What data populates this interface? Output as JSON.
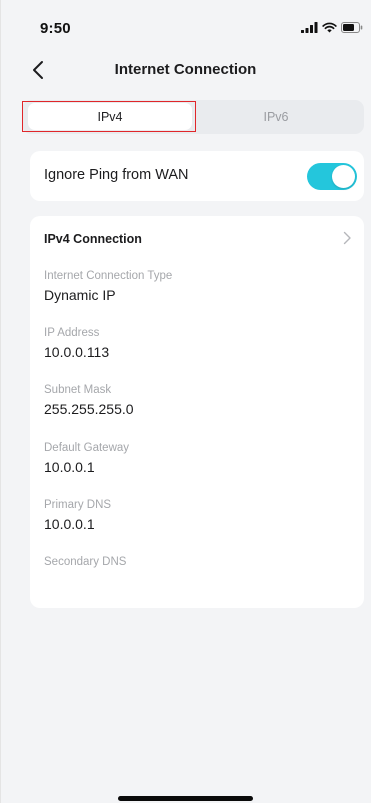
{
  "status_bar": {
    "time": "9:50",
    "icons": [
      "signal-icon",
      "wifi-icon",
      "battery-icon"
    ]
  },
  "nav": {
    "title": "Internet Connection",
    "back_icon": "chevron-left-icon"
  },
  "tabs": {
    "items": [
      {
        "label": "IPv4",
        "selected": true
      },
      {
        "label": "IPv6",
        "selected": false
      }
    ]
  },
  "ping": {
    "label": "Ignore Ping from WAN",
    "enabled": true
  },
  "connection": {
    "title": "IPv4 Connection",
    "fields": [
      {
        "label": "Internet Connection Type",
        "value": "Dynamic IP"
      },
      {
        "label": "IP Address",
        "value": "10.0.0.113"
      },
      {
        "label": "Subnet Mask",
        "value": "255.255.255.0"
      },
      {
        "label": "Default Gateway",
        "value": "10.0.0.1"
      },
      {
        "label": "Primary DNS",
        "value": "10.0.0.1"
      },
      {
        "label": "Secondary DNS",
        "value": ""
      }
    ]
  },
  "colors": {
    "accent": "#24c6dc",
    "highlight": "#e0262a",
    "background": "#f3f4f6"
  }
}
